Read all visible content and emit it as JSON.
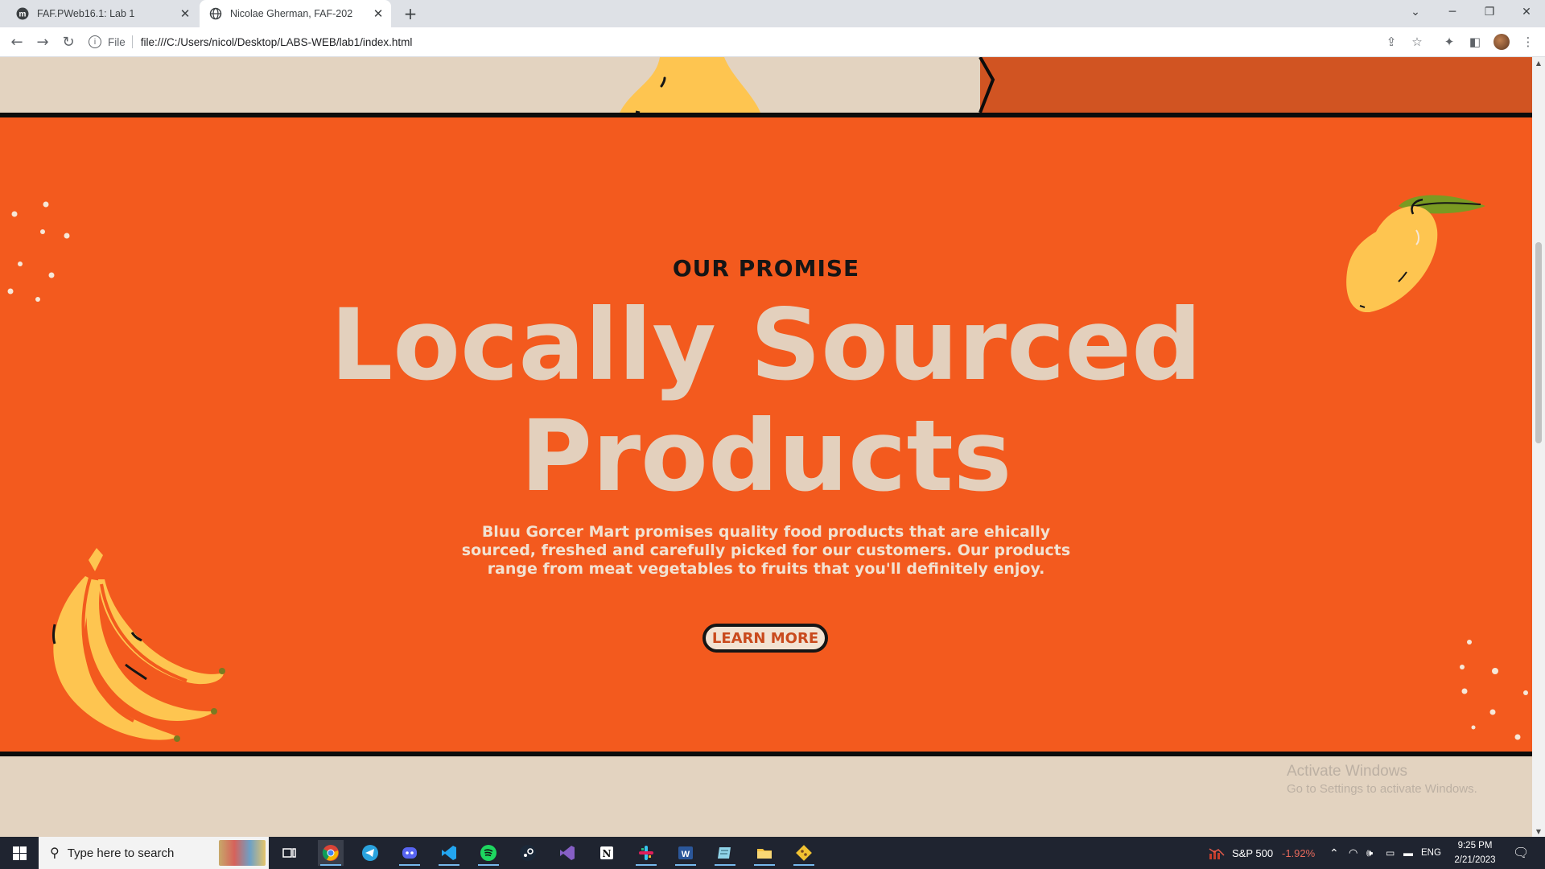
{
  "browser": {
    "tabs": [
      {
        "title": "FAF.PWeb16.1: Lab 1",
        "active": false,
        "favicon": "moodle-m-icon"
      },
      {
        "title": "Nicolae Gherman, FAF-202",
        "active": true,
        "favicon": "globe-icon"
      }
    ],
    "address": {
      "scheme": "File",
      "url": "file:///C:/Users/nicol/Desktop/LABS-WEB/lab1/index.html"
    }
  },
  "page": {
    "eyebrow": "OUR PROMISE",
    "headline_line1": "Locally Sourced",
    "headline_line2": "Products",
    "blurb": "Bluu Gorcer Mart promises quality food products that are ehically sourced, freshed and carefully picked for our customers. Our products range from meat vegetables to fruits that you'll definitely enjoy.",
    "cta": "LEARN MORE",
    "colors": {
      "section_bg": "#f35a1e",
      "cream": "#e3d3c0",
      "dark_orange_panel": "#d15422",
      "fruit_yellow": "#fec550"
    }
  },
  "windows_watermark": {
    "line1": "Activate Windows",
    "line2": "Go to Settings to activate Windows."
  },
  "taskbar": {
    "search_placeholder": "Type here to search",
    "pinned": [
      "chrome-icon",
      "telegram-icon",
      "discord-icon",
      "vscode-icon",
      "spotify-icon",
      "steam-icon",
      "visual-studio-icon",
      "notion-icon",
      "slack-icon",
      "word-icon",
      "notepad-icon",
      "file-explorer-icon",
      "git-icon"
    ],
    "stock": {
      "name": "S&P 500",
      "change": "-1.92%"
    },
    "language": "ENG",
    "time": "9:25 PM",
    "date": "2/21/2023"
  }
}
